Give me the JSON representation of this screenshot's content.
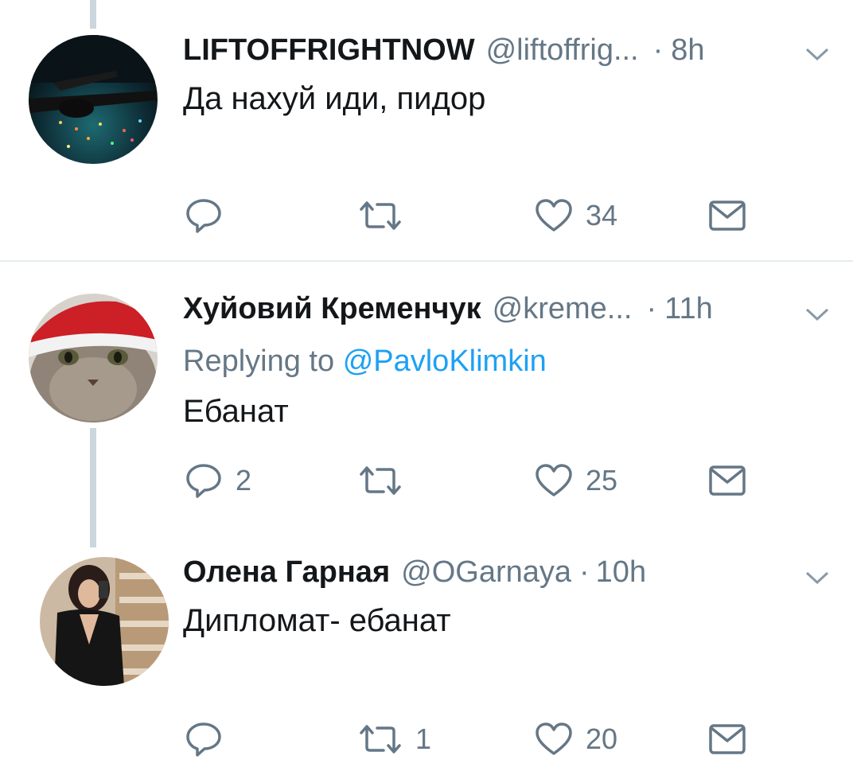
{
  "tweets": [
    {
      "display_name": "LIFTOFFRIGHTNOW",
      "handle": "@liftoffrig...",
      "time": "8h",
      "text": "Да нахуй иди, пидор",
      "reply_count": "",
      "retweet_count": "",
      "like_count": "34",
      "avatar": "airplane-night-avatar"
    },
    {
      "display_name": "Хуйовий Кременчук",
      "handle": "@kreme...",
      "time": "11h",
      "replying_prefix": "Replying to",
      "replying_to": "@PavloKlimkin",
      "text": "Ебанат",
      "reply_count": "2",
      "retweet_count": "",
      "like_count": "25",
      "avatar": "cat-santa-hat-avatar"
    },
    {
      "display_name": "Олена Гарная",
      "handle": "@OGarnaya",
      "time": "10h",
      "text": "Дипломат- ебанат",
      "reply_count": "",
      "retweet_count": "1",
      "like_count": "20",
      "avatar": "woman-mirror-selfie-avatar"
    }
  ],
  "colors": {
    "text_primary": "#14171a",
    "text_secondary": "#657786",
    "link": "#1da1f2",
    "thread_line": "#ccd6dd",
    "divider": "#e6ecf0"
  },
  "icons": [
    "reply-icon",
    "retweet-icon",
    "like-icon",
    "direct-message-icon",
    "chevron-down-icon"
  ]
}
